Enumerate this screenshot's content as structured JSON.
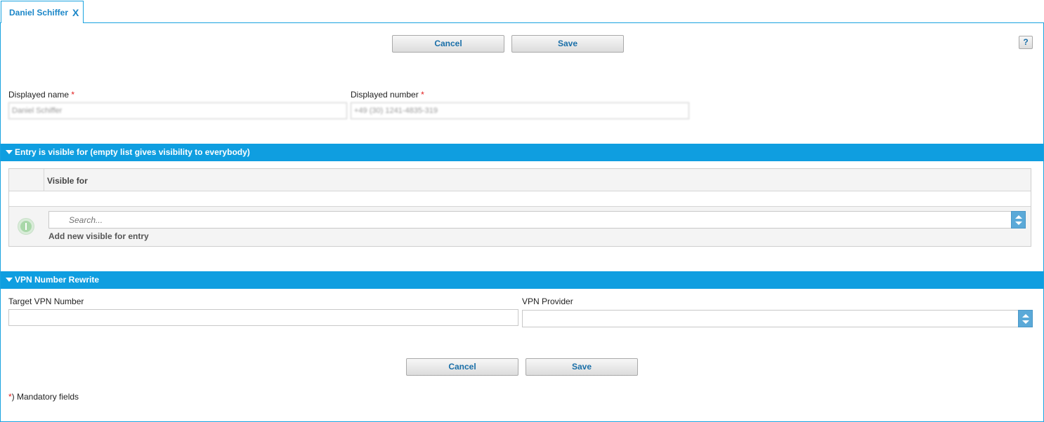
{
  "tab": {
    "title": "Daniel Schiffer",
    "close": "X"
  },
  "toolbar": {
    "cancel_label": "Cancel",
    "save_label": "Save",
    "help_label": "?"
  },
  "form": {
    "displayed_name_label": "Displayed name",
    "displayed_name_value": "Daniel Schiffer",
    "displayed_number_label": "Displayed number",
    "displayed_number_value": "+49 (30) 1241-4835-319",
    "required_mark": "*"
  },
  "visibility_section": {
    "title": "Entry is visible for (empty list gives visibility to everybody)",
    "column_header": "Visible for",
    "search_placeholder": "Search...",
    "add_label": "Add new visible for entry"
  },
  "vpn_section": {
    "title": "VPN Number Rewrite",
    "target_label": "Target VPN Number",
    "target_value": "",
    "provider_label": "VPN Provider",
    "provider_value": ""
  },
  "footer": {
    "cancel_label": "Cancel",
    "save_label": "Save",
    "mandatory_star": "*",
    "mandatory_text": ") Mandatory fields"
  },
  "colors": {
    "accent": "#0f9ee0",
    "required": "#e21c1c",
    "button_text": "#1a6fa8"
  },
  "icons": {
    "add": "plus-circle-icon",
    "close": "close-icon",
    "collapse": "triangle-down-icon",
    "spinner": "spinner-arrows-icon"
  }
}
